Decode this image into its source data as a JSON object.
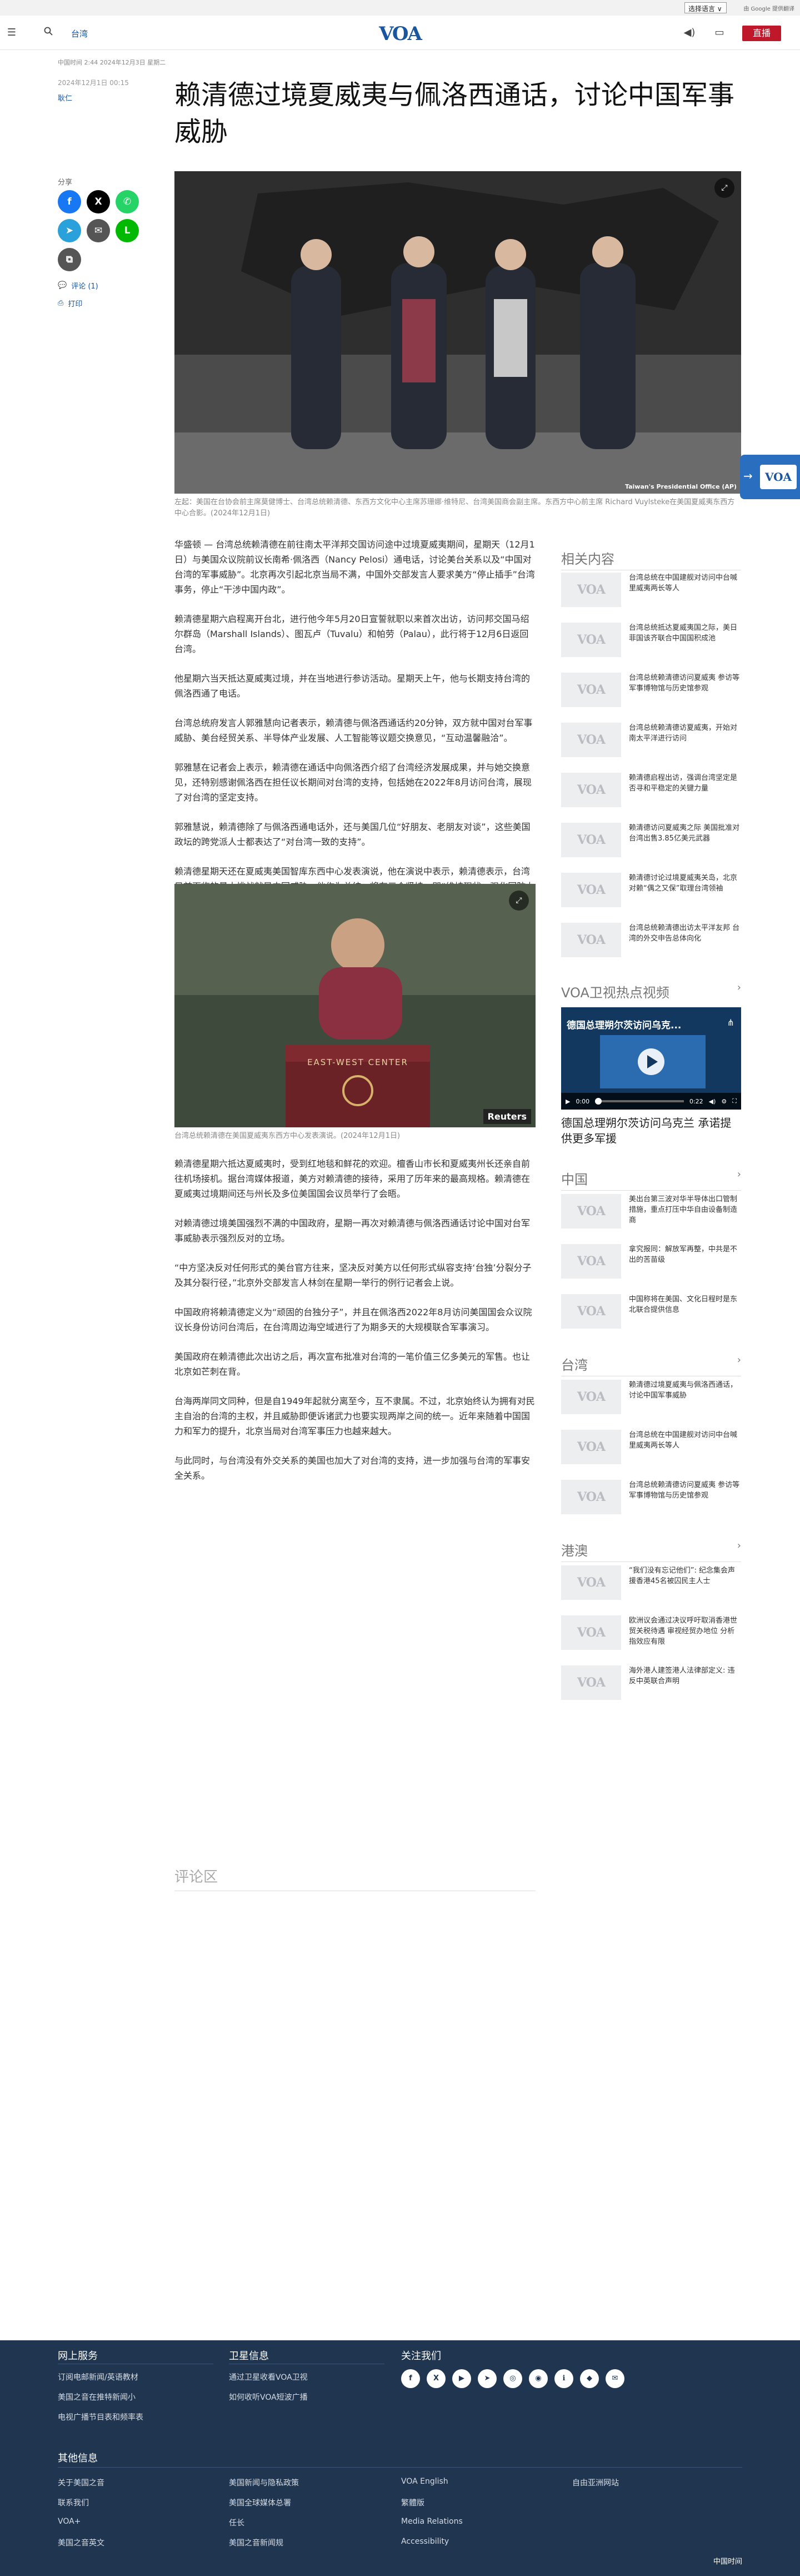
{
  "translate_bar": {
    "select_label": "选择语言 ∨",
    "powered_by": "由 Google 提供翻译"
  },
  "header": {
    "section": "台湾",
    "logo": "VOA",
    "live_label": "直播",
    "menu_icon": "menu-icon",
    "search_icon": "search-icon"
  },
  "timebar": "中国时间 2:44 2024年12月3日 星期二",
  "article": {
    "date": "2024年12月1日 00:15",
    "author": "耿仁",
    "title": "赖清德过境夏威夷与佩洛西通话，讨论中国军事威胁",
    "share_label": "分享",
    "comment_link": "评论 (1)",
    "print_link": "打印",
    "hero_caption": "左起：美国在台协会前主席莫健博士、台湾总统赖清德、东西方文化中心主席苏珊娜·维特尼、台湾美国商会副主席。东西方中心前主席 Richard Vuylsteke在美国夏威夷东西方中心合影。(2024年12月1日)",
    "hero_credit": "Taiwan's Presidential Office (AP)",
    "paragraphs_a": [
      "华盛顿 — 台湾总统赖清德在前往南太平洋邦交国访问途中过境夏威夷期间，星期天（12月1日）与美国众议院前议长南希·佩洛西（Nancy Pelosi）通电话，讨论美台关系以及“中国对台湾的军事威胁”。北京再次引起北京当局不满，中国外交部发言人要求美方“停止插手”台湾事务，停止“干涉中国内政”。",
      "赖清德星期六启程离开台北，进行他今年5月20日宣誓就职以来首次出访，访问邦交国马绍尔群岛（Marshall Islands）、图瓦卢（Tuvalu）和帕劳（Palau），此行将于12月6日返回台湾。",
      "他星期六当天抵达夏威夷过境，并在当地进行参访活动。星期天上午，他与长期支持台湾的佩洛西通了电话。",
      "台湾总统府发言人郭雅慧向记者表示，赖清德与佩洛西通话约20分钟，双方就中国对台军事威胁、美台经贸关系、半导体产业发展、人工智能等议题交换意见，“互动温馨融洽”。",
      "郭雅慧在记者会上表示，赖清德在通话中向佩洛西介绍了台湾经济发展成果，并与她交换意见，还特别感谢佩洛西在担任议长期间对台湾的支持，包括她在2022年8月访问台湾，展现了对台湾的坚定支持。",
      "郭雅慧说，赖清德除了与佩洛西通电话外，还与美国几位“好朋友、老朋友对谈”，这些美国政坛的跨党派人士都表达了“对台湾一致的支持”。",
      "赖清德星期天还在夏威夷美国智库东西中心发表演说，他在演说中表示，赖清德表示，台湾目前面临的最大挑战就是中国威胁，他作为总统，将有三个坚持：即“维持现状、强化国防力量和民主共同体”。"
    ],
    "img2_caption": "台湾总统赖清德在美国夏威夷东西方中心发表演说。(2024年12月1日)",
    "img2_credit": "Reuters",
    "img2_banner": "EAST-WEST CENTER",
    "paragraphs_b": [
      "赖清德星期六抵达夏威夷时，受到红地毯和鲜花的欢迎。檀香山市长和夏威夷州长还亲自前往机场接机。据台湾媒体报道，美方对赖清德的接待，采用了历年来的最高规格。赖清德在夏威夷过境期间还与州长及多位美国国会议员举行了会晤。",
      "对赖清德过境美国强烈不满的中国政府，星期一再次对赖清德与佩洛西通话讨论中国对台军事威胁表示强烈反对的立场。",
      "“中方坚决反对任何形式的美台官方往来，坚决反对美方以任何形式纵容支持‘台独’分裂分子及其分裂行径，”北京外交部发言人林剑在星期一举行的例行记者会上说。",
      "中国政府将赖清德定义为“顽固的台独分子”，并且在佩洛西2022年8月访问美国国会众议院议长身份访问台湾后，在台湾周边海空域进行了为期多天的大规模联合军事演习。",
      "美国政府在赖清德此次出访之后，再次宣布批准对台湾的一笔价值三亿多美元的军售。也让北京如芒刺在背。",
      "台海两岸同文同种，但是自1949年起就分离至今，互不隶属。不过，北京始终认为拥有对民主自治的台湾的主权，并且威胁即便诉诸武力也要实现两岸之间的统一。近年来随着中国国力和军力的提升，北京当局对台湾军事压力也越来越大。",
      "与此同时，与台湾没有外交关系的美国也加大了对台湾的支持，进一步加强与台湾的军事安全关系。"
    ]
  },
  "sidebar": {
    "related_title": "相关内容",
    "related": [
      "台湾总统在中国建舰对访问中台喊里威夷两长等人",
      "台湾总统抵达夏威夷国之际，美日菲国该齐联合中国国积成池",
      "台湾总统赖清德访问夏威夷 参访等军事博物馆与历史馆参观",
      "台湾总统赖清德访夏威夷，开始对南太平洋进行访问",
      "赖清德启程出访，强调台湾坚定是否寻和平稳定的关键力量",
      "赖清德访问夏威夷之际 美国批准对台湾出售3.85亿美元武器",
      "赖清德讨论过境夏威夷关岛，北京对赖“偶之又保”取理台湾领袖",
      "台湾总统赖清德出访太平洋友邦 台湾的外交申告总体向化"
    ],
    "video_title": "VOA卫视热点视频",
    "video_overlay": "德国总理朔尔茨访问乌克...",
    "video_time": "0:00",
    "video_duration": "0:22",
    "video_caption": "德国总理朔尔茨访问乌克兰 承诺提供更多军援",
    "china_title": "中国",
    "china": [
      "美出台第三波对华半导体出口管制措施，重点打压中华自由设备制造商",
      "拿究报同：解放军再整，中共是不出的苦苗级",
      "中国称将在美国、文化日程时是东北联合提供信息"
    ],
    "taiwan_title": "台湾",
    "taiwan": [
      "赖清德过境夏威夷与佩洛西通话，讨论中国军事威胁",
      "台湾总统在中国建舰对访问中台喊里威夷两长等人",
      "台湾总统赖清德访问夏威夷 参访等军事博物馆与历史馆参观"
    ],
    "hk_title": "港澳",
    "hk": [
      "“我们没有忘记他们”: 纪念集会声援香港45名被囚民主人士",
      "欧洲议会通过决议呼吁取消香港世贸关税待遇 审视经贸办地位 分析指效应有限",
      "海外港人建签港人法律部定义: 违反中英联合声明"
    ]
  },
  "comments_title": "评论区",
  "footer": {
    "col1_title": "网上服务",
    "col1": [
      "订阅电邮新闻/英语教材",
      "美国之音在推特新闻小",
      "电视广播节目表和频率表"
    ],
    "col2_title": "卫星信息",
    "col2": [
      "通过卫星收看VOA卫视",
      "如何收听VOA短波广播"
    ],
    "col3_title": "关注我们",
    "social": [
      "f",
      "X",
      "▶",
      "➤",
      "◎",
      "◉",
      "ℹ",
      "◆",
      "✉"
    ],
    "other_title": "其他信息",
    "other": [
      [
        "关于美国之音",
        "联系我们",
        "VOA+",
        "美国之音英文"
      ],
      [
        "美国新闻与隐私政策",
        "美国全球媒体总署",
        "任长",
        "美国之音新闻规"
      ],
      [
        "VOA English",
        "繁體版",
        "Media Relations",
        "Accessibility"
      ],
      [
        "自由亚洲网站"
      ]
    ],
    "copyright": "中国时间"
  }
}
